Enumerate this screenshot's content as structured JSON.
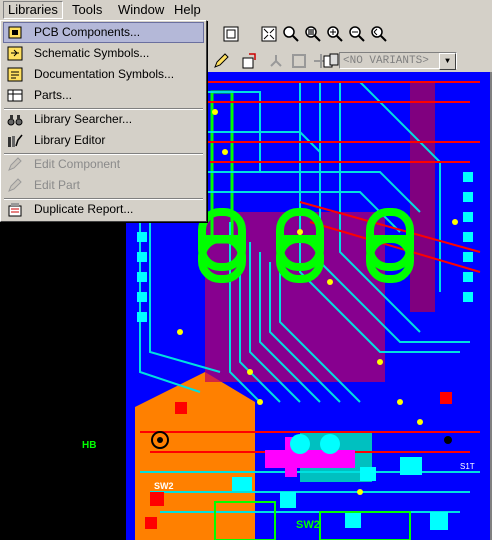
{
  "menubar": {
    "items": [
      "Libraries",
      "Tools",
      "Window",
      "Help"
    ]
  },
  "libraries_menu": {
    "items": [
      {
        "label": "PCB Components...",
        "icon": "pcb-components-icon",
        "enabled": true,
        "selected": true
      },
      {
        "label": "Schematic Symbols...",
        "icon": "schematic-symbols-icon",
        "enabled": true
      },
      {
        "label": "Documentation Symbols...",
        "icon": "documentation-symbols-icon",
        "enabled": true
      },
      {
        "label": "Parts...",
        "icon": "parts-icon",
        "enabled": true
      },
      {
        "label": "Library Searcher...",
        "icon": "binoculars-icon",
        "enabled": true
      },
      {
        "label": "Library Editor",
        "icon": "library-editor-icon",
        "enabled": true
      },
      {
        "label": "Edit Component",
        "icon": "edit-component-icon",
        "enabled": false
      },
      {
        "label": "Edit Part",
        "icon": "edit-part-icon",
        "enabled": false
      },
      {
        "label": "Duplicate Report...",
        "icon": "duplicate-report-icon",
        "enabled": true
      }
    ]
  },
  "toolbar": {
    "variants_value": "<NO VARIANTS>"
  },
  "pcb": {
    "display_digits": "888",
    "labels": {
      "sw2_left": "SW2",
      "sw2_bottom": "SW2",
      "s1t": "S1T",
      "hb": "HB"
    }
  },
  "colors": {
    "menu_bg": "#d4d0c8",
    "menu_highlight": "#b4b8d8",
    "board_blue": "#0000ff",
    "copper_red": "#ff0000",
    "trace_cyan": "#00e0e0",
    "silk_green": "#00ff00",
    "pad_yellow": "#ffff00",
    "orange_pour": "#ff8000",
    "magenta": "#ff00ff"
  }
}
